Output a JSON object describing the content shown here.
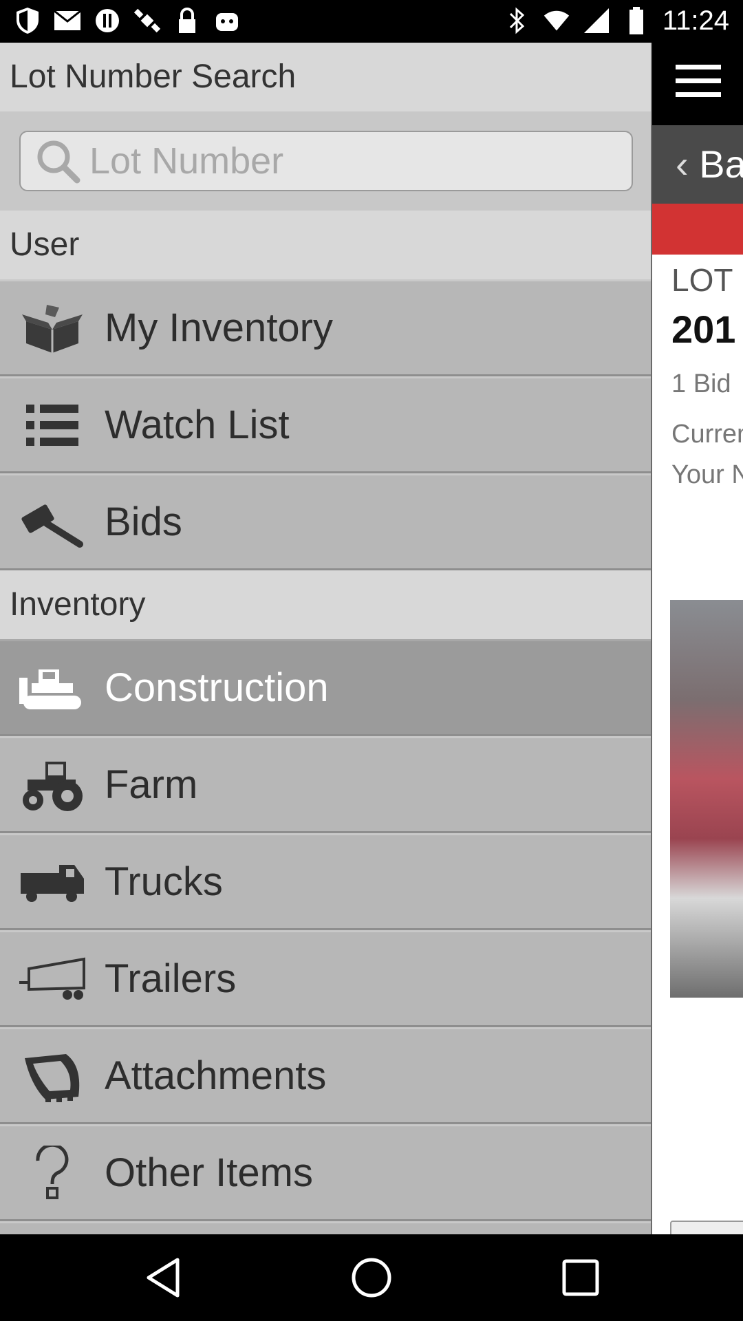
{
  "status_bar": {
    "time": "11:24",
    "left_icons": [
      "shield-icon",
      "mail-icon",
      "alert-icon",
      "satellite-icon",
      "lock-icon",
      "android-icon"
    ],
    "right_icons": [
      "bluetooth-icon",
      "wifi-icon",
      "signal-icon",
      "battery-icon"
    ]
  },
  "drawer": {
    "search_title": "Lot Number Search",
    "search_placeholder": "Lot Number",
    "user_section": "User",
    "user_items": [
      {
        "label": "My Inventory",
        "icon": "open-box-icon"
      },
      {
        "label": "Watch List",
        "icon": "list-icon"
      },
      {
        "label": "Bids",
        "icon": "gavel-icon"
      }
    ],
    "inventory_section": "Inventory",
    "inventory_items": [
      {
        "label": "Construction",
        "icon": "bulldozer-icon",
        "active": true
      },
      {
        "label": "Farm",
        "icon": "tractor-icon"
      },
      {
        "label": "Trucks",
        "icon": "truck-icon"
      },
      {
        "label": "Trailers",
        "icon": "trailer-icon"
      },
      {
        "label": "Attachments",
        "icon": "bucket-icon"
      },
      {
        "label": "Other Items",
        "icon": "question-icon"
      }
    ]
  },
  "background_screen": {
    "back_label": "Ba",
    "lot_label": "LOT",
    "year_partial": "201",
    "bid_text": "1 Bid",
    "current_text": "Curren",
    "your_text": "Your N",
    "accent_color": "#d23333"
  },
  "nav_bar": {
    "buttons": [
      "back-icon",
      "home-icon",
      "recents-icon"
    ]
  }
}
